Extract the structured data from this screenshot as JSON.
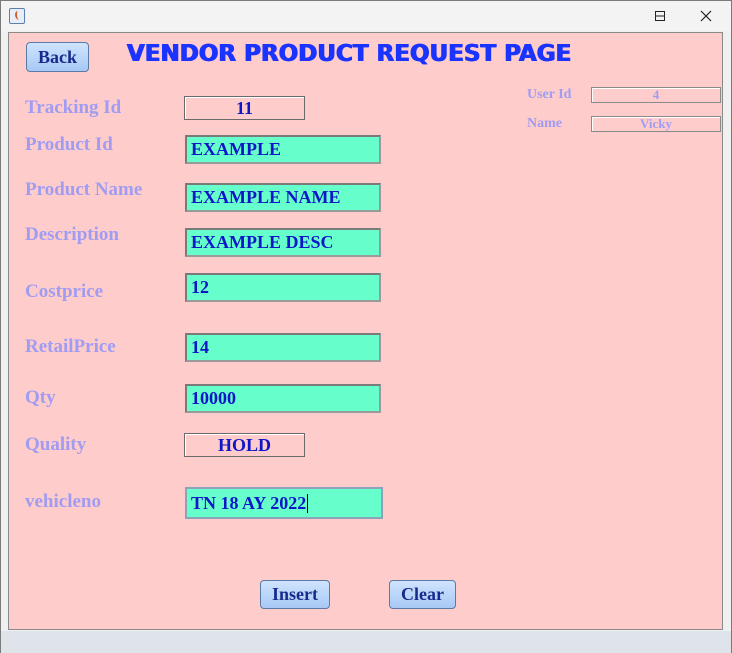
{
  "window": {
    "minimize_icon": "minimize-icon",
    "maximize_icon": "maximize-icon",
    "close_icon": "close-icon"
  },
  "header": {
    "back_label": "Back",
    "title": "VENDOR PRODUCT REQUEST PAGE"
  },
  "user": {
    "user_id_label": "User Id",
    "user_id_value": "4",
    "name_label": "Name",
    "name_value": "Vicky"
  },
  "form": {
    "tracking_id_label": "Tracking Id",
    "tracking_id_value": "11",
    "product_id_label": "Product Id",
    "product_id_value": "EXAMPLE",
    "product_name_label": "Product Name",
    "product_name_value": "EXAMPLE NAME",
    "description_label": "Description",
    "description_value": "EXAMPLE DESC",
    "costprice_label": "Costprice",
    "costprice_value": "12",
    "retailprice_label": "RetailPrice",
    "retailprice_value": "14",
    "qty_label": "Qty",
    "qty_value": "10000",
    "quality_label": "Quality",
    "quality_value": "HOLD",
    "vehicleno_label": "vehicleno",
    "vehicleno_value": "TN 18 AY 2022"
  },
  "actions": {
    "insert_label": "Insert",
    "clear_label": "Clear"
  },
  "colors": {
    "background": "#ffcccc",
    "field": "#66ffcc",
    "title": "#1a33ff",
    "label": "#a09cf2",
    "value": "#0f16c8"
  }
}
